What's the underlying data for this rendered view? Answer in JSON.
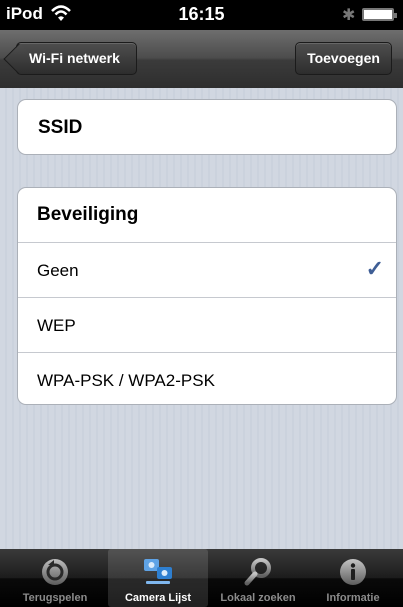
{
  "status": {
    "device": "iPod",
    "time": "16:15",
    "wifi_icon": "wifi-icon",
    "bluetooth_icon": "bluetooth-icon",
    "battery_icon": "battery-icon"
  },
  "nav": {
    "back_label": "Wi-Fi netwerk",
    "add_label": "Toevoegen"
  },
  "ssid": {
    "label": "SSID"
  },
  "security": {
    "header": "Beveiliging",
    "options": [
      {
        "label": "Geen",
        "selected": true
      },
      {
        "label": "WEP",
        "selected": false
      },
      {
        "label": "WPA-PSK / WPA2-PSK",
        "selected": false
      }
    ],
    "check_glyph": "✓",
    "check_color": "#3f5e95"
  },
  "tabs": [
    {
      "label": "Terugspelen",
      "icon": "playback-icon",
      "active": false
    },
    {
      "label": "Camera Lijst",
      "icon": "camera-list-icon",
      "active": true
    },
    {
      "label": "Lokaal zoeken",
      "icon": "search-icon",
      "active": false
    },
    {
      "label": "Informatie",
      "icon": "info-icon",
      "active": false
    }
  ]
}
